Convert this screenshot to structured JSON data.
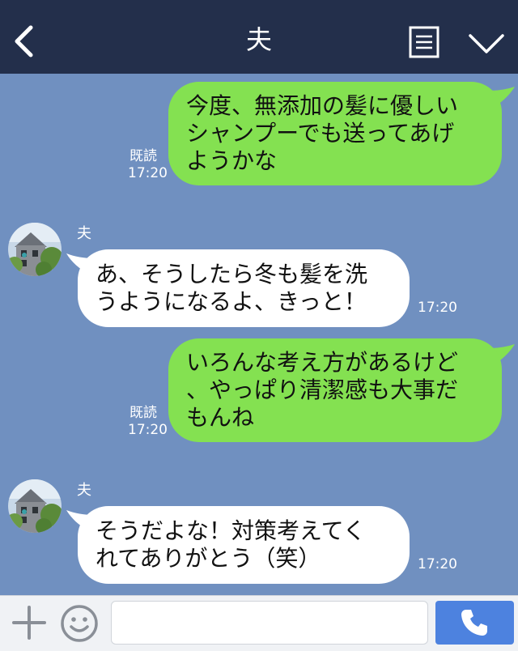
{
  "header": {
    "title": "夫",
    "back_icon": "chevron-left-icon",
    "note_icon": "note-icon",
    "menu_icon": "chevron-down-icon"
  },
  "messages": [
    {
      "direction": "outgoing",
      "lines": [
        "今度、無添加の髪に優しい",
        "シャンプーでも送ってあげ",
        "ようかな"
      ],
      "read": "既読",
      "time": "17:20"
    },
    {
      "direction": "incoming",
      "sender": "夫",
      "lines": [
        "あ、そうしたら冬も髪を洗",
        "うようになるよ、きっと！"
      ],
      "time": "17:20"
    },
    {
      "direction": "outgoing",
      "lines": [
        "いろんな考え方があるけど",
        "、やっぱり清潔感も大事だ",
        "もんね"
      ],
      "read": "既読",
      "time": "17:20"
    },
    {
      "direction": "incoming",
      "sender": "夫",
      "lines": [
        "そうだよな！対策考えてく",
        "れてありがとう（笑）"
      ],
      "time": "17:20"
    }
  ],
  "footer": {
    "input_value": "",
    "plus_icon": "plus-icon",
    "smile_icon": "smile-icon",
    "call_icon": "phone-icon"
  },
  "colors": {
    "header_bg": "#232f4b",
    "chat_bg": "#7090c0",
    "outgoing_bubble": "#84e151",
    "incoming_bubble": "#ffffff",
    "call_button": "#4d82df"
  }
}
